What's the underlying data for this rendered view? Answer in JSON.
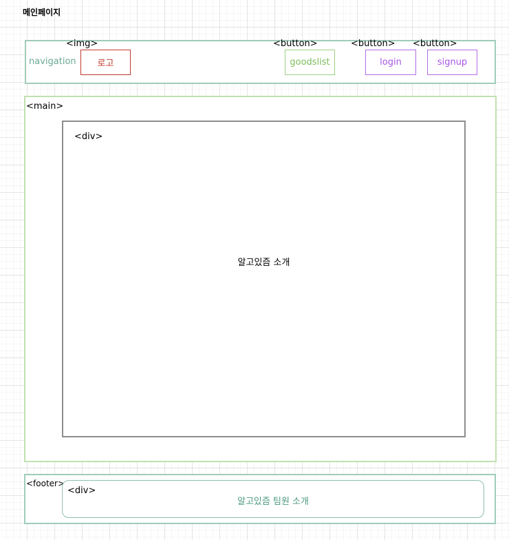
{
  "page": {
    "title": "메인페이지"
  },
  "navigation": {
    "label": "navigation",
    "logo": {
      "tag": "<img>",
      "label": "로고"
    },
    "goodslist": {
      "tag": "<button>",
      "label": "goodslist"
    },
    "login": {
      "tag": "<button>",
      "label": "login"
    },
    "signup": {
      "tag": "<button>",
      "label": "signup"
    }
  },
  "main": {
    "tag": "<main>",
    "div": {
      "tag": "<div>",
      "text": "알고있즘 소개"
    }
  },
  "footer": {
    "tag": "<footer>",
    "div": {
      "tag": "<div>",
      "text": "알고있즘 팀원 소개"
    }
  },
  "colors": {
    "navigation_border": "#9fccb8",
    "logo": "#c0392b",
    "goodslist": "#7cbd5c",
    "auth_buttons": "#a855e6",
    "main_border": "#bfe0b0",
    "footer_text": "#4e9a82"
  }
}
